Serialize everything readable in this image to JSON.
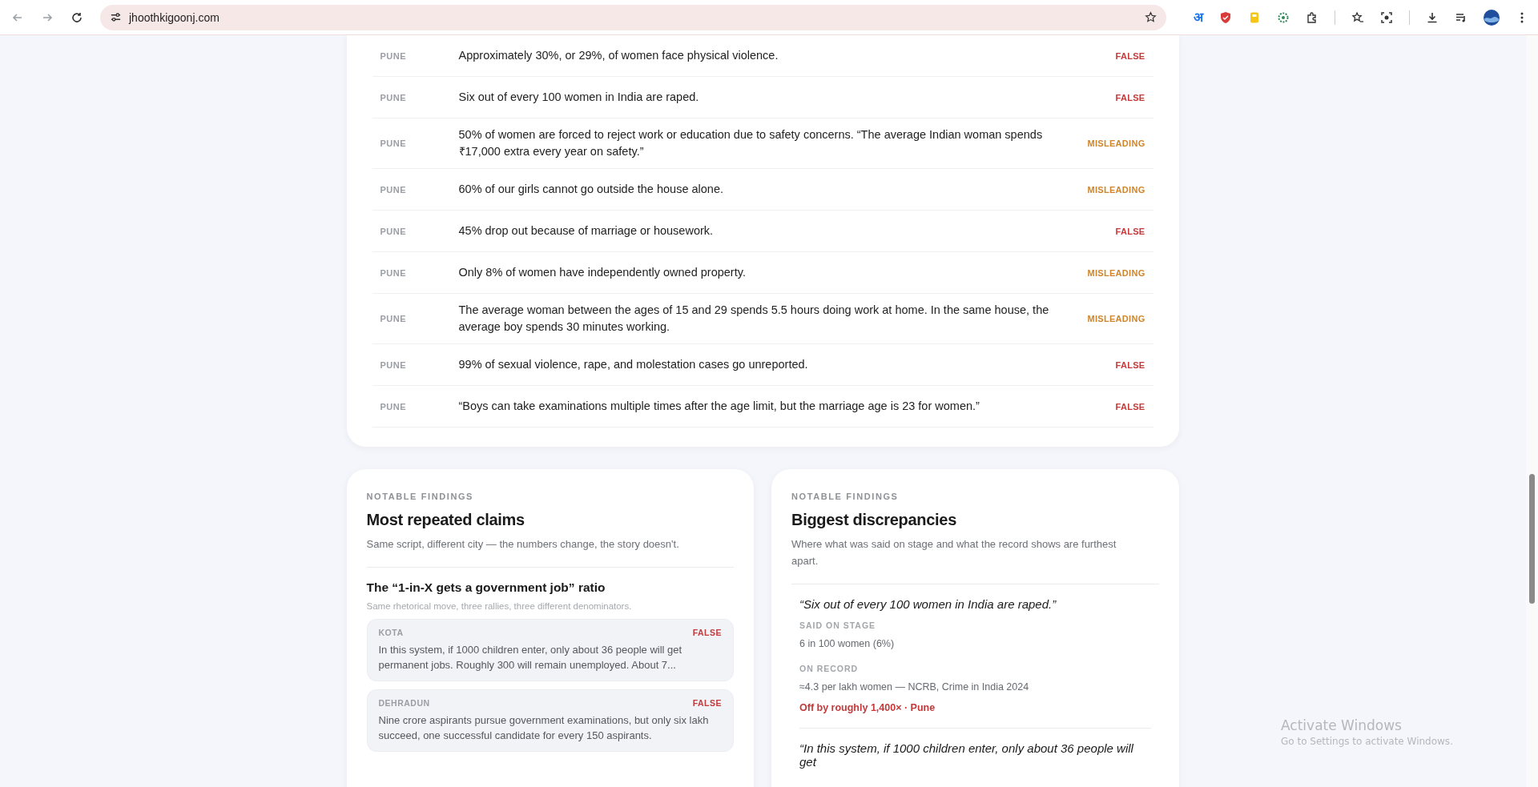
{
  "browser": {
    "url": "jhoothkigoonj.com",
    "extension_letter": "अ"
  },
  "claims_table": {
    "rows": [
      {
        "city": "PUNE",
        "claim": "Approximately 30%, or 29%, of women face physical violence.",
        "verdict": "FALSE",
        "kind": "false"
      },
      {
        "city": "PUNE",
        "claim": "Six out of every 100 women in India are raped.",
        "verdict": "FALSE",
        "kind": "false"
      },
      {
        "city": "PUNE",
        "claim": "50% of women are forced to reject work or education due to safety concerns. “The average Indian woman spends ₹17,000 extra every year on safety.”",
        "verdict": "MISLEADING",
        "kind": "misleading"
      },
      {
        "city": "PUNE",
        "claim": "60% of our girls cannot go outside the house alone.",
        "verdict": "MISLEADING",
        "kind": "misleading"
      },
      {
        "city": "PUNE",
        "claim": "45% drop out because of marriage or housework.",
        "verdict": "FALSE",
        "kind": "false"
      },
      {
        "city": "PUNE",
        "claim": "Only 8% of women have independently owned property.",
        "verdict": "MISLEADING",
        "kind": "misleading"
      },
      {
        "city": "PUNE",
        "claim": "The average woman between the ages of 15 and 29 spends 5.5 hours doing work at home. In the same house, the average boy spends 30 minutes working.",
        "verdict": "MISLEADING",
        "kind": "misleading"
      },
      {
        "city": "PUNE",
        "claim": "99% of sexual violence, rape, and molestation cases go unreported.",
        "verdict": "FALSE",
        "kind": "false"
      },
      {
        "city": "PUNE",
        "claim": "“Boys can take examinations multiple times after the age limit, but the marriage age is 23 for women.”",
        "verdict": "FALSE",
        "kind": "false"
      }
    ]
  },
  "findings": [
    {
      "kind": "repeated",
      "eyebrow": "NOTABLE FINDINGS",
      "title": "Most repeated claims",
      "subtitle": "Same script, different city — the numbers change, the story doesn't.",
      "group": {
        "title": "The “1-in-X gets a government job” ratio",
        "note": "Same rhetorical move, three rallies, three different denominators.",
        "claims": [
          {
            "city": "KOTA",
            "verdict": "FALSE",
            "kind": "false",
            "text": "In this system, if 1000 children enter, only about 36 people will get permanent jobs. Roughly 300 will remain unemployed. About 7..."
          },
          {
            "city": "DEHRADUN",
            "verdict": "FALSE",
            "kind": "false",
            "text": "Nine crore aspirants pursue government examinations, but only six lakh succeed, one successful candidate for every 150 aspirants."
          }
        ]
      }
    },
    {
      "kind": "discrepancy",
      "eyebrow": "NOTABLE FINDINGS",
      "title": "Biggest discrepancies",
      "subtitle": "Where what was said on stage and what the record shows are furthest apart.",
      "items": [
        {
          "quote": "“Six out of every 100 women in India are raped.”",
          "said_label": "SAID ON STAGE",
          "said_value": "6 in 100 women (6%)",
          "record_label": "ON RECORD",
          "record_value": "≈4.3 per lakh women — NCRB, Crime in India 2024",
          "gap": "Off by roughly 1,400× · Pune"
        },
        {
          "quote": "“In this system, if 1000 children enter, only about 36 people will get"
        }
      ]
    }
  ],
  "os_notice": {
    "title": "Activate Windows",
    "text": "Go to Settings to activate Windows."
  }
}
